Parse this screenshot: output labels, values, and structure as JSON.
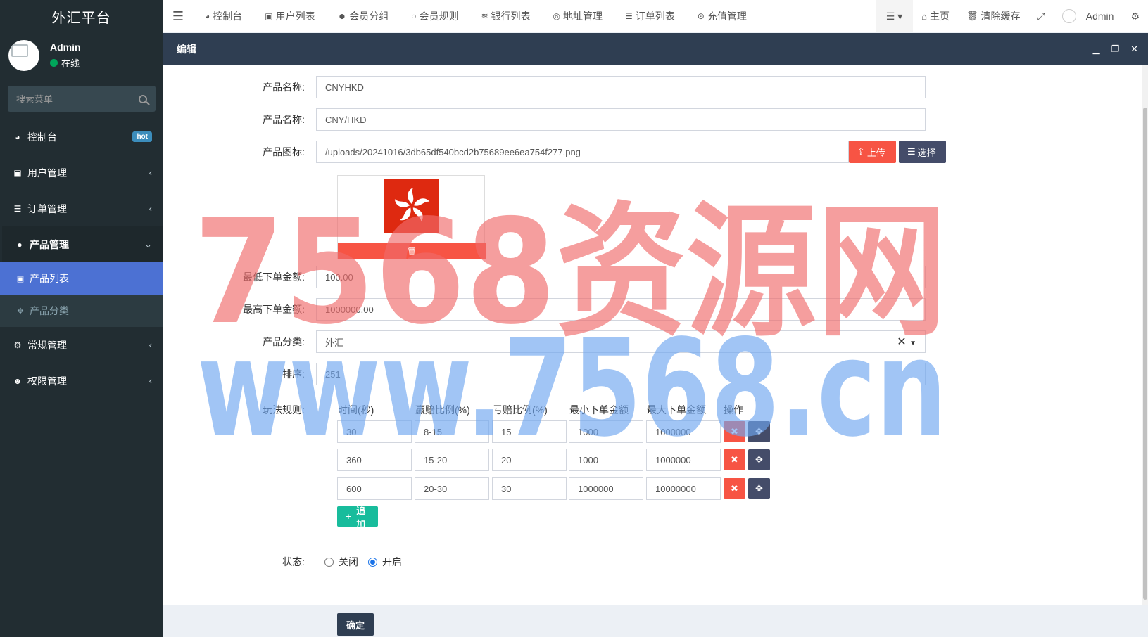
{
  "app": {
    "title": "外汇平台"
  },
  "user": {
    "name": "Admin",
    "status": "在线"
  },
  "sidebar": {
    "search_placeholder": "搜索菜单",
    "items": [
      {
        "label": "控制台",
        "icon": "dashboard-icon",
        "badge": "hot"
      },
      {
        "label": "用户管理",
        "icon": "user-icon"
      },
      {
        "label": "订单管理",
        "icon": "list-icon"
      },
      {
        "label": "产品管理",
        "icon": "product-icon"
      },
      {
        "label": "常规管理",
        "icon": "cogs-icon"
      },
      {
        "label": "权限管理",
        "icon": "group-icon"
      }
    ],
    "submenu": [
      {
        "label": "产品列表",
        "icon": "product-list-icon"
      },
      {
        "label": "产品分类",
        "icon": "category-icon"
      }
    ]
  },
  "topnav": {
    "tabs": [
      {
        "label": "控制台",
        "icon": "dashboard-icon"
      },
      {
        "label": "用户列表",
        "icon": "user-icon"
      },
      {
        "label": "会员分组",
        "icon": "group-icon"
      },
      {
        "label": "会员规则",
        "icon": "circle-icon"
      },
      {
        "label": "银行列表",
        "icon": "database-icon"
      },
      {
        "label": "地址管理",
        "icon": "address-icon"
      },
      {
        "label": "订单列表",
        "icon": "list-icon"
      },
      {
        "label": "充值管理",
        "icon": "recharge-icon"
      }
    ],
    "home": "主页",
    "clear_cache": "清除缓存",
    "admin": "Admin"
  },
  "modal": {
    "title": "编辑",
    "form": {
      "product_name_label": "产品名称:",
      "product_name_value": "CNYHKD",
      "product_title_label": "产品名称:",
      "product_title_value": "CNY/HKD",
      "product_icon_label": "产品图标:",
      "product_icon_value": "/uploads/20241016/3db65df540bcd2b75689ee6ea754f277.png",
      "upload_btn": "上传",
      "choose_btn": "选择",
      "min_amount_label": "最低下单金额:",
      "min_amount_value": "100.00",
      "max_amount_label": "最高下单金额:",
      "max_amount_value": "1000000.00",
      "category_label": "产品分类:",
      "category_value": "外汇",
      "sort_label": "排序:",
      "sort_value": "251",
      "rules_label": "玩法规则:",
      "rules_headers": [
        "时间(秒)",
        "赢赔比例(%)",
        "亏赔比例(%)",
        "最小下单金额",
        "最大下单金额",
        "操作"
      ],
      "rules_rows": [
        [
          "30",
          "8-15",
          "15",
          "1000",
          "1000000"
        ],
        [
          "360",
          "15-20",
          "20",
          "1000",
          "1000000"
        ],
        [
          "600",
          "20-30",
          "30",
          "1000000",
          "10000000"
        ]
      ],
      "add_btn": "追加",
      "status_label": "状态:",
      "status_options": [
        "关闭",
        "开启"
      ],
      "status_selected": "开启"
    },
    "confirm_btn": "确定"
  },
  "watermark": {
    "line1": "7568资源网",
    "line2": "www.7568.cn"
  },
  "colors": {
    "sidebar_bg": "#222d32",
    "accent": "#4c71d3",
    "modal_header": "#2f3e52",
    "danger": "#f75444",
    "success": "#18bc9c"
  }
}
